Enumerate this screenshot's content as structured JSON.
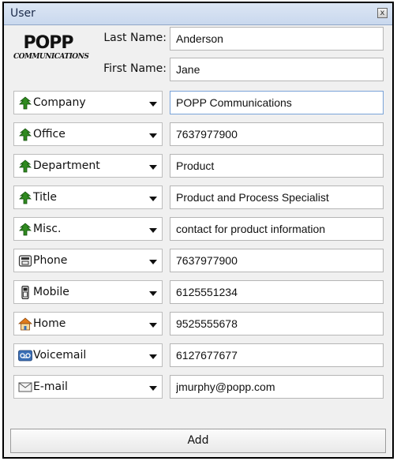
{
  "window": {
    "title": "User",
    "close_glyph": "x"
  },
  "logo": {
    "main": "POPP",
    "sub": "COMMUNICATIONS"
  },
  "last_name": {
    "label": "Last Name:",
    "value": "Anderson"
  },
  "first_name": {
    "label": "First Name:",
    "value": "Jane"
  },
  "fields": [
    {
      "label": "Company",
      "icon": "tree-icon",
      "value": "POPP Communications"
    },
    {
      "label": "Office",
      "icon": "tree-icon",
      "value": "7637977900"
    },
    {
      "label": "Department",
      "icon": "tree-icon",
      "value": "Product"
    },
    {
      "label": "Title",
      "icon": "tree-icon",
      "value": "Product and Process Specialist"
    },
    {
      "label": "Misc.",
      "icon": "tree-icon",
      "value": "contact for product information"
    },
    {
      "label": "Phone",
      "icon": "phone-icon",
      "value": "7637977900"
    },
    {
      "label": "Mobile",
      "icon": "mobile-icon",
      "value": "6125551234"
    },
    {
      "label": "Home",
      "icon": "home-icon",
      "value": "9525555678"
    },
    {
      "label": "Voicemail",
      "icon": "voicemail-icon",
      "value": "6127677677"
    },
    {
      "label": "E-mail",
      "icon": "email-icon",
      "value": "jmurphy@popp.com"
    }
  ],
  "add_button": {
    "label": "Add"
  },
  "colors": {
    "accent": "#7aa3d8",
    "tree": "#2f8a1f",
    "home_roof": "#e07b1a",
    "voicemail": "#3b6fb6"
  }
}
